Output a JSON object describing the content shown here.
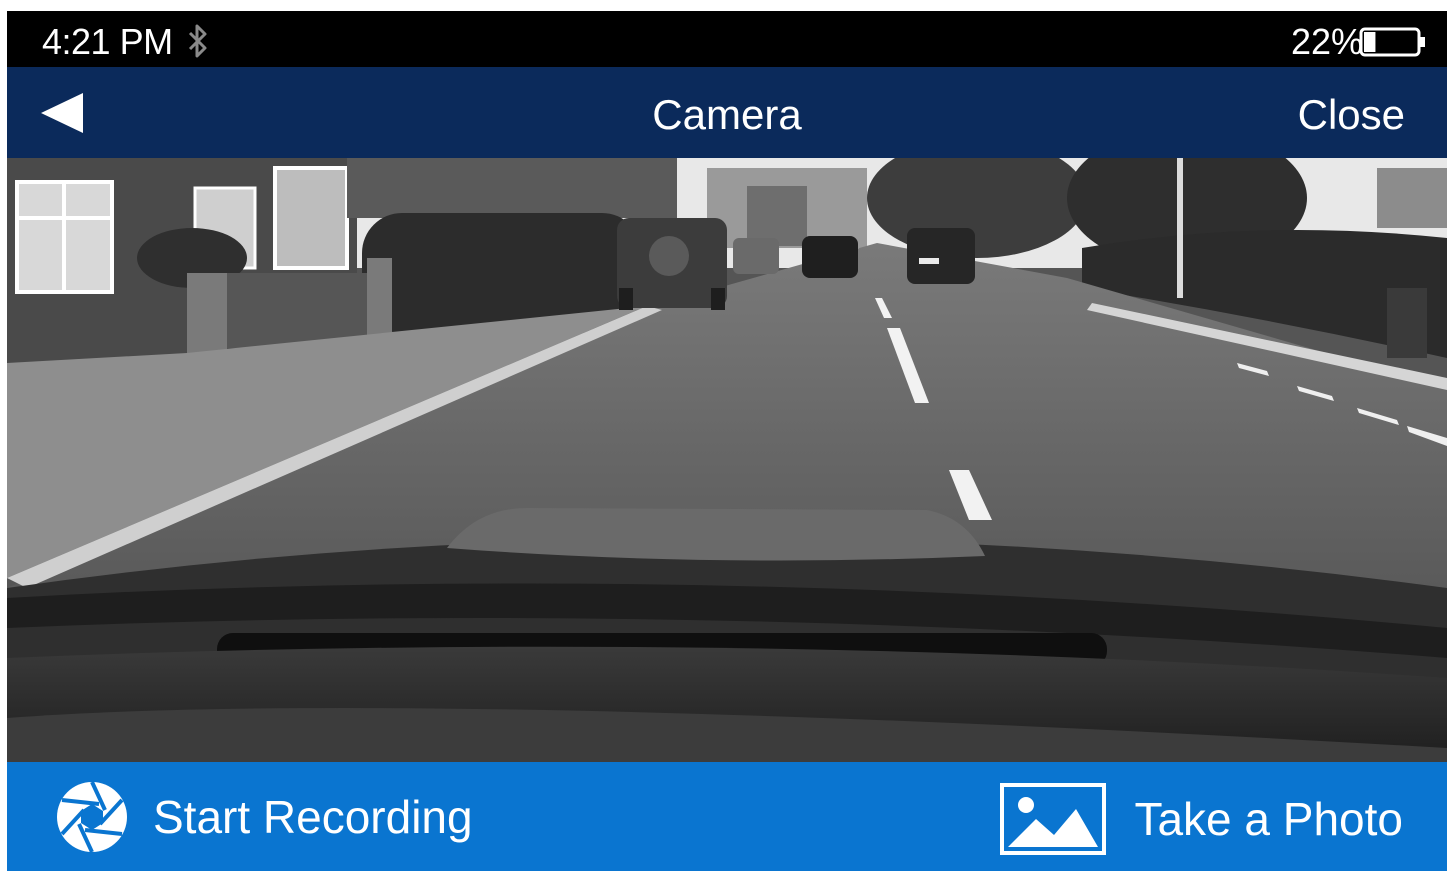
{
  "status_bar": {
    "time": "4:21 PM",
    "bluetooth_icon": "bluetooth-icon",
    "battery_percent": "22%",
    "battery_level": 0.22,
    "battery_icon": "battery-icon"
  },
  "nav_bar": {
    "back_icon": "back-arrow-icon",
    "title": "Camera",
    "close_label": "Close"
  },
  "camera_view": {
    "scene": "dashcam-street-view"
  },
  "bottom_bar": {
    "record_icon": "aperture-icon",
    "record_label": "Start Recording",
    "photo_icon": "image-icon",
    "photo_label": "Take a Photo"
  },
  "colors": {
    "status_bar_bg": "#000000",
    "nav_bar_bg": "#0b2a5b",
    "bottom_bar_bg": "#0a75d0",
    "text": "#ffffff"
  }
}
